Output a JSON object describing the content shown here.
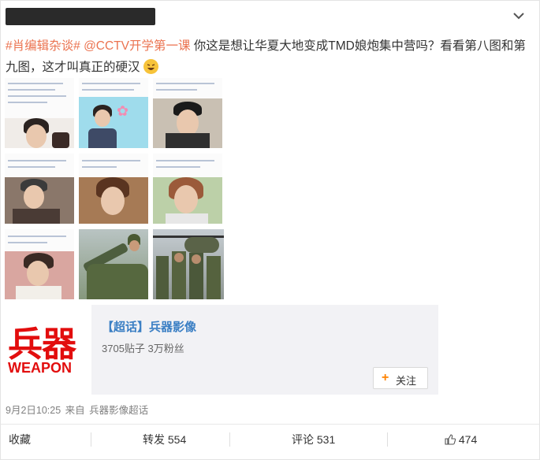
{
  "post": {
    "author_name": "",
    "text": {
      "tag": "#肖编辑杂谈#",
      "mention": "@CCTV开学第一课",
      "body": " 你这是想让华夏大地变成TMD娘炮集中营吗？看看第八图和第九图，这才叫真正的硬汉"
    },
    "emoji": "laugh-icon",
    "images": [
      {
        "label": "image-1",
        "kind": "screenshot-portrait"
      },
      {
        "label": "image-2",
        "kind": "screenshot-poster"
      },
      {
        "label": "image-3",
        "kind": "screenshot-portrait"
      },
      {
        "label": "image-4",
        "kind": "screenshot-portrait"
      },
      {
        "label": "image-5",
        "kind": "screenshot-portrait"
      },
      {
        "label": "image-6",
        "kind": "screenshot-portrait"
      },
      {
        "label": "image-7",
        "kind": "screenshot-portrait"
      },
      {
        "label": "image-8",
        "kind": "soldier-tank"
      },
      {
        "label": "image-9",
        "kind": "soldiers-helicopter"
      }
    ]
  },
  "share_card": {
    "logo_cn": "兵器",
    "logo_en": "WEAPON",
    "title": "【超话】兵器影像",
    "stats": "3705贴子 3万粉丝",
    "follow_label": "关注"
  },
  "meta": {
    "time": "9月2日10:25",
    "from_label": "来自",
    "source": "兵器影像超话"
  },
  "actions": {
    "favorite": "收藏",
    "repost": "转发 554",
    "comment": "评论 531",
    "like": "474"
  },
  "colors": {
    "accent": "#eb7350",
    "link": "#3b7fc4",
    "logo_red": "#e20d0d",
    "follow_plus": "#ff8200"
  }
}
